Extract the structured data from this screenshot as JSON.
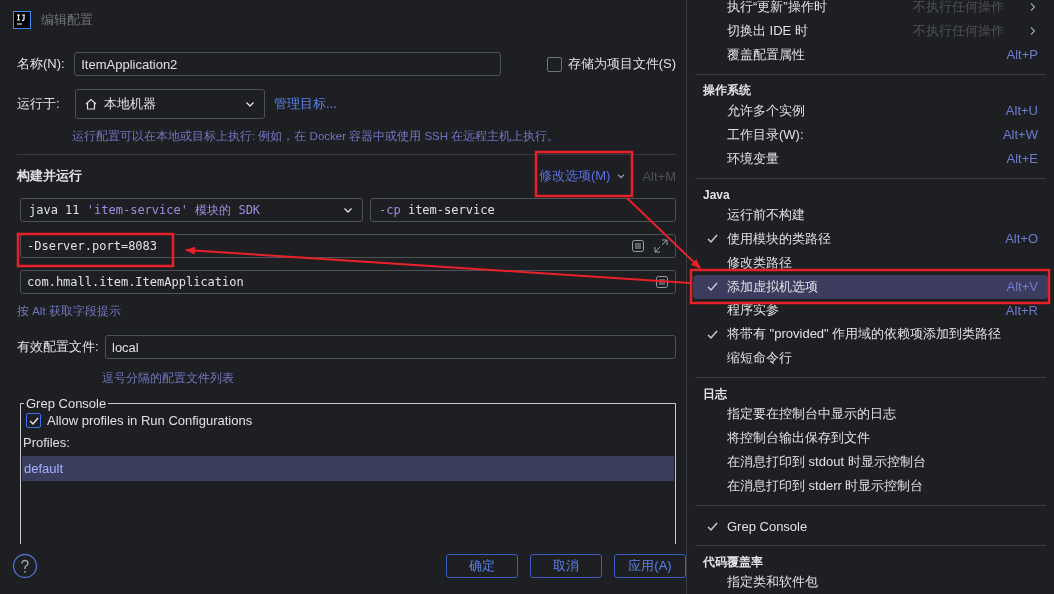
{
  "dialog": {
    "title": "编辑配置",
    "name_label": "名称(N):",
    "name_value": "ItemApplication2",
    "store_as_file": {
      "label": "存储为项目文件(S)",
      "checked": false
    },
    "run_on_label": "运行于:",
    "run_on_value": "本地机器",
    "manage_targets": "管理目标...",
    "run_on_hint": "运行配置可以在本地或目标上执行: 例如，在 Docker 容器中或使用 SSH 在远程主机上执行。",
    "section_title": "构建并运行",
    "modify_options": "修改选项(M)",
    "modify_shortcut": "Alt+M",
    "sdk_version": "java 11",
    "sdk_detail": "'item-service' 模块的 SDK",
    "classpath_flag": "-cp",
    "classpath_module": "item-service",
    "vm_options": "-Dserver.port=8083",
    "main_class": "com.hmall.item.ItemApplication",
    "alt_hint": "按 Alt 获取字段提示",
    "profiles_label": "有效配置文件:",
    "profiles_value": "local",
    "profiles_hint": "逗号分隔的配置文件列表",
    "grep_console": {
      "title": "Grep Console",
      "allow": {
        "label": "Allow profiles in Run Configurations",
        "checked": true
      },
      "profiles_label": "Profiles:",
      "profiles": [
        {
          "name": "default",
          "selected": true
        }
      ]
    },
    "buttons": [
      "确定",
      "取消",
      "应用(A)"
    ]
  },
  "menu": {
    "entries": [
      {
        "kind": "item",
        "label": "执行“更新”操作时",
        "value": "不执行任何操作",
        "submenu": true,
        "checked": false,
        "selected": false
      },
      {
        "kind": "item",
        "label": "切换出 IDE 时",
        "value": "不执行任何操作",
        "submenu": true,
        "checked": false,
        "selected": false
      },
      {
        "kind": "item",
        "label": "覆盖配置属性",
        "shortcut": "Alt+P",
        "submenu": false,
        "checked": false,
        "selected": false
      },
      {
        "kind": "separator"
      },
      {
        "kind": "header",
        "label": "操作系统"
      },
      {
        "kind": "item",
        "label": "允许多个实例",
        "shortcut": "Alt+U",
        "submenu": false,
        "checked": false,
        "selected": false
      },
      {
        "kind": "item",
        "label": "工作目录(W):",
        "shortcut": "Alt+W",
        "submenu": false,
        "checked": false,
        "selected": false
      },
      {
        "kind": "item",
        "label": "环境变量",
        "shortcut": "Alt+E",
        "submenu": false,
        "checked": false,
        "selected": false
      },
      {
        "kind": "separator"
      },
      {
        "kind": "header",
        "label": "Java"
      },
      {
        "kind": "item",
        "label": "运行前不构建",
        "submenu": false,
        "checked": false,
        "selected": false
      },
      {
        "kind": "item",
        "label": "使用模块的类路径",
        "shortcut": "Alt+O",
        "submenu": false,
        "checked": true,
        "selected": false
      },
      {
        "kind": "item",
        "label": "修改类路径",
        "submenu": false,
        "checked": false,
        "selected": false
      },
      {
        "kind": "item",
        "label": "添加虚拟机选项",
        "shortcut": "Alt+V",
        "submenu": false,
        "checked": true,
        "selected": true
      },
      {
        "kind": "item",
        "label": "程序实参",
        "shortcut": "Alt+R",
        "submenu": false,
        "checked": false,
        "selected": false
      },
      {
        "kind": "item",
        "label": "将带有 \"provided\" 作用域的依赖项添加到类路径",
        "submenu": false,
        "checked": true,
        "selected": false
      },
      {
        "kind": "item",
        "label": "缩短命令行",
        "submenu": false,
        "checked": false,
        "selected": false
      },
      {
        "kind": "separator"
      },
      {
        "kind": "header",
        "label": "日志"
      },
      {
        "kind": "item",
        "label": "指定要在控制台中显示的日志",
        "submenu": false,
        "checked": false,
        "selected": false
      },
      {
        "kind": "item",
        "label": "将控制台输出保存到文件",
        "submenu": false,
        "checked": false,
        "selected": false
      },
      {
        "kind": "item",
        "label": "在消息打印到 stdout 时显示控制台",
        "submenu": false,
        "checked": false,
        "selected": false
      },
      {
        "kind": "item",
        "label": "在消息打印到 stderr 时显示控制台",
        "submenu": false,
        "checked": false,
        "selected": false
      },
      {
        "kind": "separator"
      },
      {
        "kind": "item",
        "label": "Grep Console",
        "submenu": false,
        "checked": true,
        "selected": false
      },
      {
        "kind": "separator"
      },
      {
        "kind": "header",
        "label": "代码覆盖率"
      },
      {
        "kind": "item",
        "label": "指定类和软件包",
        "submenu": false,
        "checked": false,
        "selected": false
      }
    ]
  }
}
